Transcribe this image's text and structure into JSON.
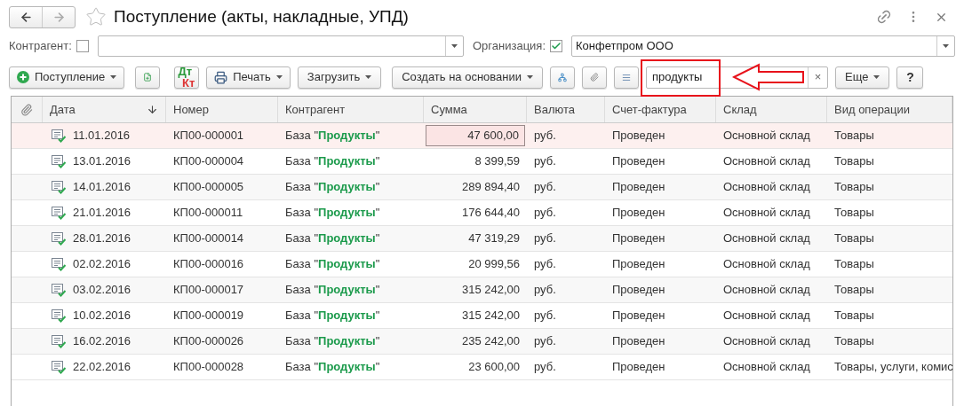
{
  "window": {
    "title": "Поступление (акты, накладные, УПД)",
    "favorite": false
  },
  "filters": [
    {
      "label": "Контрагент:",
      "checked": false
    },
    {
      "label": "Организация:",
      "checked": true,
      "value": "Конфетпром ООО"
    }
  ],
  "toolbar": [
    {
      "kind": "create",
      "label": "Поступление",
      "dropdown": true
    },
    {
      "kind": "copy"
    },
    {
      "kind": "dtkt",
      "label_top": "Дт",
      "label_bottom": "Кт"
    },
    {
      "kind": "print",
      "label": "Печать",
      "dropdown": true
    },
    {
      "kind": "load",
      "label": "Загрузить",
      "dropdown": true
    },
    {
      "kind": "based_on",
      "label": "Создать на основании",
      "dropdown": true
    },
    {
      "kind": "structure"
    },
    {
      "kind": "attach"
    },
    {
      "kind": "list"
    },
    {
      "kind": "search",
      "value": "продукты",
      "clear": "×",
      "highlighted": true
    },
    {
      "kind": "more",
      "label": "Еще",
      "dropdown": true
    },
    {
      "kind": "help",
      "label": "?"
    }
  ],
  "table": {
    "columns": [
      {
        "sorted": false
      },
      {
        "label": "Дата",
        "sorted": true
      },
      {
        "label": "Номер",
        "sorted": false
      },
      {
        "label": "Контрагент",
        "sorted": false
      },
      {
        "label": "Сумма",
        "sorted": false
      },
      {
        "label": "Валюта",
        "sorted": false
      },
      {
        "label": "Счет-фактура",
        "sorted": false
      },
      {
        "label": "Склад",
        "sorted": false
      },
      {
        "label": "Вид операции",
        "sorted": false
      }
    ],
    "rows": [
      {
        "selected": true,
        "posted": true,
        "date": "11.01.2016",
        "number": "КП00-000001",
        "counterparty": "База \"**Продукты**\"",
        "amount": "47 600,00",
        "currency": "руб.",
        "invoice": "Проведен",
        "warehouse": "Основной склад",
        "operation": "Товары"
      },
      {
        "selected": false,
        "posted": true,
        "date": "13.01.2016",
        "number": "КП00-000004",
        "counterparty": "База \"**Продукты**\"",
        "amount": "8 399,59",
        "currency": "руб.",
        "invoice": "Проведен",
        "warehouse": "Основной склад",
        "operation": "Товары"
      },
      {
        "selected": false,
        "posted": true,
        "date": "14.01.2016",
        "number": "КП00-000005",
        "counterparty": "База \"**Продукты**\"",
        "amount": "289 894,40",
        "currency": "руб.",
        "invoice": "Проведен",
        "warehouse": "Основной склад",
        "operation": "Товары"
      },
      {
        "selected": false,
        "posted": true,
        "date": "21.01.2016",
        "number": "КП00-000011",
        "counterparty": "База \"**Продукты**\"",
        "amount": "176 644,40",
        "currency": "руб.",
        "invoice": "Проведен",
        "warehouse": "Основной склад",
        "operation": "Товары"
      },
      {
        "selected": false,
        "posted": true,
        "date": "28.01.2016",
        "number": "КП00-000014",
        "counterparty": "База \"**Продукты**\"",
        "amount": "47 319,29",
        "currency": "руб.",
        "invoice": "Проведен",
        "warehouse": "Основной склад",
        "operation": "Товары"
      },
      {
        "selected": false,
        "posted": true,
        "date": "02.02.2016",
        "number": "КП00-000016",
        "counterparty": "База \"**Продукты**\"",
        "amount": "20 999,56",
        "currency": "руб.",
        "invoice": "Проведен",
        "warehouse": "Основной склад",
        "operation": "Товары"
      },
      {
        "selected": false,
        "posted": true,
        "date": "03.02.2016",
        "number": "КП00-000017",
        "counterparty": "База \"**Продукты**\"",
        "amount": "315 242,00",
        "currency": "руб.",
        "invoice": "Проведен",
        "warehouse": "Основной склад",
        "operation": "Товары"
      },
      {
        "selected": false,
        "posted": true,
        "date": "10.02.2016",
        "number": "КП00-000019",
        "counterparty": "База \"**Продукты**\"",
        "amount": "315 242,00",
        "currency": "руб.",
        "invoice": "Проведен",
        "warehouse": "Основной склад",
        "operation": "Товары"
      },
      {
        "selected": false,
        "posted": true,
        "date": "16.02.2016",
        "number": "КП00-000026",
        "counterparty": "База \"**Продукты**\"",
        "amount": "235 242,00",
        "currency": "руб.",
        "invoice": "Проведен",
        "warehouse": "Основной склад",
        "operation": "Товары"
      },
      {
        "selected": false,
        "posted": true,
        "date": "22.02.2016",
        "number": "КП00-000028",
        "counterparty": "База \"**Продукты**\"",
        "amount": "23 600,00",
        "currency": "руб.",
        "invoice": "Проведен",
        "warehouse": "Основной склад",
        "operation": "Товары, услуги, комис"
      }
    ]
  }
}
